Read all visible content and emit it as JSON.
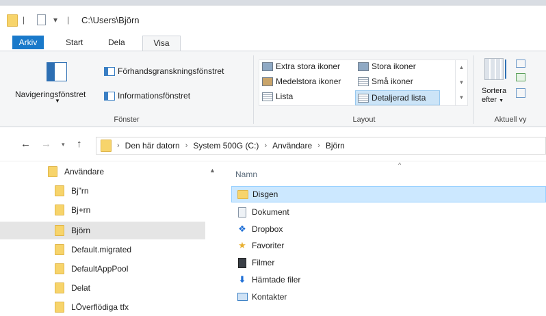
{
  "window": {
    "title": "C:\\Users\\Björn"
  },
  "ribbon_tabs": [
    "Arkiv",
    "Start",
    "Dela",
    "Visa"
  ],
  "ribbon": {
    "panes_group": {
      "label": "Fönster",
      "navigation_pane": "Navigeringsfönstret",
      "preview_pane": "Förhandsgranskningsfönstret",
      "details_pane": "Informationsfönstret"
    },
    "layout_group": {
      "label": "Layout",
      "options": [
        "Extra stora ikoner",
        "Stora ikoner",
        "Medelstora ikoner",
        "Små ikoner",
        "Lista",
        "Detaljerad lista"
      ],
      "selected": "Detaljerad lista"
    },
    "current_view_group": {
      "label": "Aktuell vy",
      "sort_by_line1": "Sortera",
      "sort_by_line2": "efter"
    }
  },
  "address_bar": {
    "breadcrumbs": [
      "Den här datorn",
      "System 500G (C:)",
      "Användare",
      "Björn"
    ]
  },
  "sidebar": {
    "parent": "Användare",
    "items": [
      "Bj\"rn",
      "Bj+rn",
      "Björn",
      "Default.migrated",
      "DefaultAppPool",
      "Delat",
      "LÖverflödiga tfx"
    ],
    "selected": "Björn"
  },
  "file_list": {
    "column_name": "Namn",
    "items": [
      {
        "name": "Disgen",
        "icon": "folder-icon"
      },
      {
        "name": "Dokument",
        "icon": "documents-icon"
      },
      {
        "name": "Dropbox",
        "icon": "dropbox-icon"
      },
      {
        "name": "Favoriter",
        "icon": "star-icon"
      },
      {
        "name": "Filmer",
        "icon": "film-icon"
      },
      {
        "name": "Hämtade filer",
        "icon": "download-icon"
      },
      {
        "name": "Kontakter",
        "icon": "contacts-icon"
      }
    ],
    "selected": "Disgen"
  },
  "colors": {
    "file_tab": "#1979ca",
    "selection": "#cce8ff",
    "folder": "#f7d46b"
  }
}
